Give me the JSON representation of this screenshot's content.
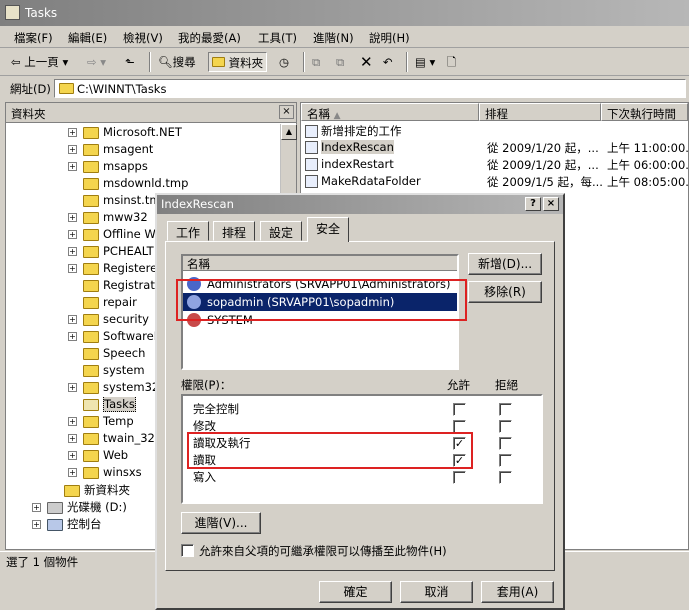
{
  "window": {
    "title": "Tasks"
  },
  "menu": [
    "檔案(F)",
    "編輯(E)",
    "檢視(V)",
    "我的最愛(A)",
    "工具(T)",
    "進階(N)",
    "說明(H)"
  ],
  "toolbar": {
    "back": "上一頁",
    "search": "搜尋",
    "folders": "資料夾"
  },
  "address": {
    "label": "網址(D)",
    "value": "C:\\WINNT\\Tasks"
  },
  "left_pane": {
    "title": "資料夾",
    "close": "×"
  },
  "tree": [
    {
      "label": "Microsoft.NET",
      "pm": "+"
    },
    {
      "label": "msagent",
      "pm": "+"
    },
    {
      "label": "msapps",
      "pm": "+"
    },
    {
      "label": "msdownld.tmp",
      "pm": ""
    },
    {
      "label": "msinst.tmp",
      "pm": ""
    },
    {
      "label": "mww32",
      "pm": "+"
    },
    {
      "label": "Offline We",
      "pm": "+"
    },
    {
      "label": "PCHEALT",
      "pm": "+"
    },
    {
      "label": "Registeredl",
      "pm": "+"
    },
    {
      "label": "Registratio",
      "pm": ""
    },
    {
      "label": "repair",
      "pm": ""
    },
    {
      "label": "security",
      "pm": "+"
    },
    {
      "label": "SoftwareDi",
      "pm": "+"
    },
    {
      "label": "Speech",
      "pm": ""
    },
    {
      "label": "system",
      "pm": ""
    },
    {
      "label": "system32",
      "pm": "+"
    },
    {
      "label": "Tasks",
      "pm": ""
    },
    {
      "label": "Temp",
      "pm": "+"
    },
    {
      "label": "twain_32",
      "pm": "+"
    },
    {
      "label": "Web",
      "pm": "+"
    },
    {
      "label": "winsxs",
      "pm": "+"
    },
    {
      "label": "新資料夾",
      "pm": ""
    },
    {
      "label": "光碟機 (D:)",
      "pm": "+"
    },
    {
      "label": "控制台",
      "pm": "+"
    }
  ],
  "columns": {
    "name": "名稱",
    "schedule": "排程",
    "next_run": "下次執行時間"
  },
  "files": [
    {
      "name": "新增排定的工作",
      "schedule": "",
      "next": ""
    },
    {
      "name": "IndexRescan",
      "schedule": "從 2009/1/20 起，...",
      "next": "上午 11:00:00..."
    },
    {
      "name": "indexRestart",
      "schedule": "從 2009/1/20 起，...",
      "next": "上午 06:00:00..."
    },
    {
      "name": "MakeRdataFolder",
      "schedule": "從 2009/1/5 起，每...",
      "next": "上午 08:05:00..."
    }
  ],
  "status": "選了 1 個物件",
  "dialog": {
    "title": "IndexRescan",
    "help": "?",
    "close": "×",
    "tabs": [
      "工作",
      "排程",
      "設定",
      "安全"
    ],
    "name_header": "名稱",
    "users": [
      "Administrators (SRVAPP01\\Administrators)",
      "sopadmin (SRVAPP01\\sopadmin)",
      "SYSTEM"
    ],
    "add": "新增(D)...",
    "remove": "移除(R)",
    "perm_label": "權限(P)：",
    "allow": "允許",
    "deny": "拒絕",
    "perms": [
      {
        "name": "完全控制",
        "allow": "",
        "deny": ""
      },
      {
        "name": "修改",
        "allow": "",
        "deny": ""
      },
      {
        "name": "讀取及執行",
        "allow": "✓",
        "deny": ""
      },
      {
        "name": "讀取",
        "allow": "✓",
        "deny": ""
      },
      {
        "name": "寫入",
        "allow": "",
        "deny": ""
      }
    ],
    "advanced": "進階(V)...",
    "inherit": "允許來自父項的可繼承權限可以傳播至此物件(H)",
    "ok": "確定",
    "cancel": "取消",
    "apply": "套用(A)"
  }
}
